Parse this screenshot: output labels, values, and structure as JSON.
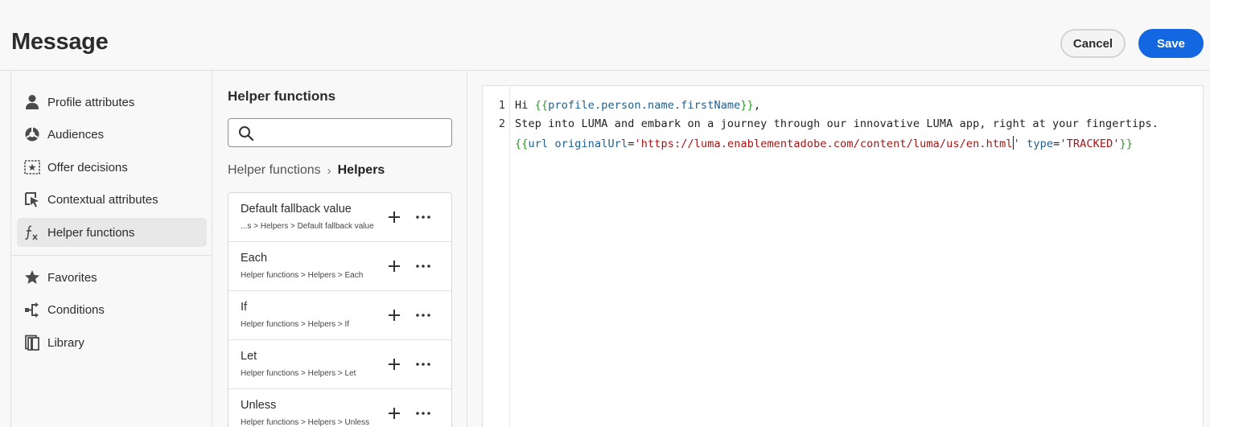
{
  "header": {
    "title": "Message",
    "cancel_label": "Cancel",
    "save_label": "Save"
  },
  "sidebar": {
    "items": [
      {
        "label": "Profile attributes",
        "icon": "person-icon"
      },
      {
        "label": "Audiences",
        "icon": "audiences-icon"
      },
      {
        "label": "Offer decisions",
        "icon": "offer-icon"
      },
      {
        "label": "Contextual attributes",
        "icon": "contextual-icon"
      },
      {
        "label": "Helper functions",
        "icon": "function-icon",
        "active": true
      },
      {
        "label": "Favorites",
        "icon": "star-icon"
      },
      {
        "label": "Conditions",
        "icon": "conditions-icon"
      },
      {
        "label": "Library",
        "icon": "library-icon"
      }
    ]
  },
  "helpers_panel": {
    "title": "Helper functions",
    "search_placeholder": "",
    "breadcrumb": [
      "Helper functions",
      "Helpers"
    ],
    "items": [
      {
        "title": "Default fallback value",
        "path": "...s > Helpers > Default fallback value"
      },
      {
        "title": "Each",
        "path": "Helper functions > Helpers > Each"
      },
      {
        "title": "If",
        "path": "Helper functions > Helpers > If"
      },
      {
        "title": "Let",
        "path": "Helper functions > Helpers > Let"
      },
      {
        "title": "Unless",
        "path": "Helper functions > Helpers > Unless"
      }
    ]
  },
  "editor": {
    "line_numbers": [
      "1",
      "2"
    ],
    "line1": {
      "prefix": "Hi ",
      "open": "{{",
      "expr": "profile.person.name.firstName",
      "close": "}}",
      "suffix": ","
    },
    "line2": "Step into LUMA and embark on a journey through our innovative LUMA app, right at your fingertips.",
    "line3": {
      "open": "{{",
      "helper": "url",
      "attr1": "originalUrl",
      "eq1": "=",
      "val1a": "'https://luma.enablementadobe.com/content/luma/us/en.html",
      "val1b": "'",
      "attr2": "type",
      "eq2": "=",
      "val2": "'TRACKED'",
      "close": "}}"
    }
  },
  "colors": {
    "accent": "#1367e0",
    "brace": "#2f9a2f",
    "variable": "#1f5e8e",
    "string": "#a31515"
  }
}
